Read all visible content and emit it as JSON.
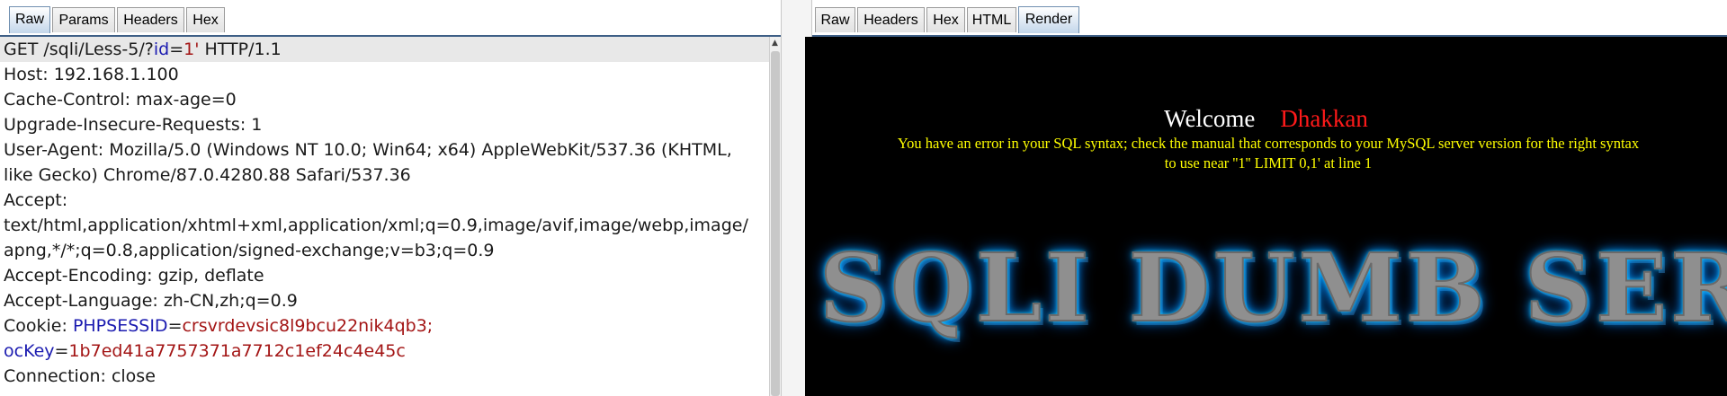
{
  "request_tabs": [
    "Raw",
    "Params",
    "Headers",
    "Hex"
  ],
  "request_active_tab": "Raw",
  "response_tabs": [
    "Raw",
    "Headers",
    "Hex",
    "HTML",
    "Render"
  ],
  "response_active_tab": "Render",
  "request": {
    "request_line": {
      "prefix": "GET /sqli/Less-5/?",
      "param_name": "id",
      "eq": "=",
      "param_value": "1'",
      "suffix": " HTTP/1.1"
    },
    "host": "Host: 192.168.1.100",
    "cache_control": "Cache-Control: max-age=0",
    "upgrade": "Upgrade-Insecure-Requests: 1",
    "user_agent_1": "User-Agent: Mozilla/5.0 (Windows NT 10.0; Win64; x64) AppleWebKit/537.36 (KHTML,",
    "user_agent_2": "like Gecko) Chrome/87.0.4280.88 Safari/537.36",
    "accept": "Accept:",
    "accept_value_1": "text/html,application/xhtml+xml,application/xml;q=0.9,image/avif,image/webp,image/",
    "accept_value_2": "apng,*/*;q=0.8,application/signed-exchange;v=b3;q=0.9",
    "accept_encoding": "Accept-Encoding: gzip, deflate",
    "accept_language": "Accept-Language: zh-CN,zh;q=0.9",
    "cookie_label": "Cookie: ",
    "cookie_1_name": "PHPSESSID",
    "cookie_1_value": "crsvrdevsic8l9bcu22nik4qb3;",
    "cookie_2_name": "ocKey",
    "cookie_2_value": "1b7ed41a7757371a7712c1ef24c4e45c",
    "connection": "Connection: close"
  },
  "render": {
    "welcome": "Welcome",
    "user": "Dhakkan",
    "error_line_1": "You have an error in your SQL syntax; check the manual that corresponds to your MySQL server version for the right syntax",
    "error_line_2": "to use near ''1'' LIMIT 0,1' at line 1",
    "banner": "SQLI DUMB SERIES"
  },
  "colors": {
    "param_name": "#1b1bb0",
    "param_value": "#a31515",
    "render_bg": "#000000",
    "error_text": "#ffff00",
    "user_name": "#ff1a1a",
    "banner_glow": "#00aaff"
  }
}
